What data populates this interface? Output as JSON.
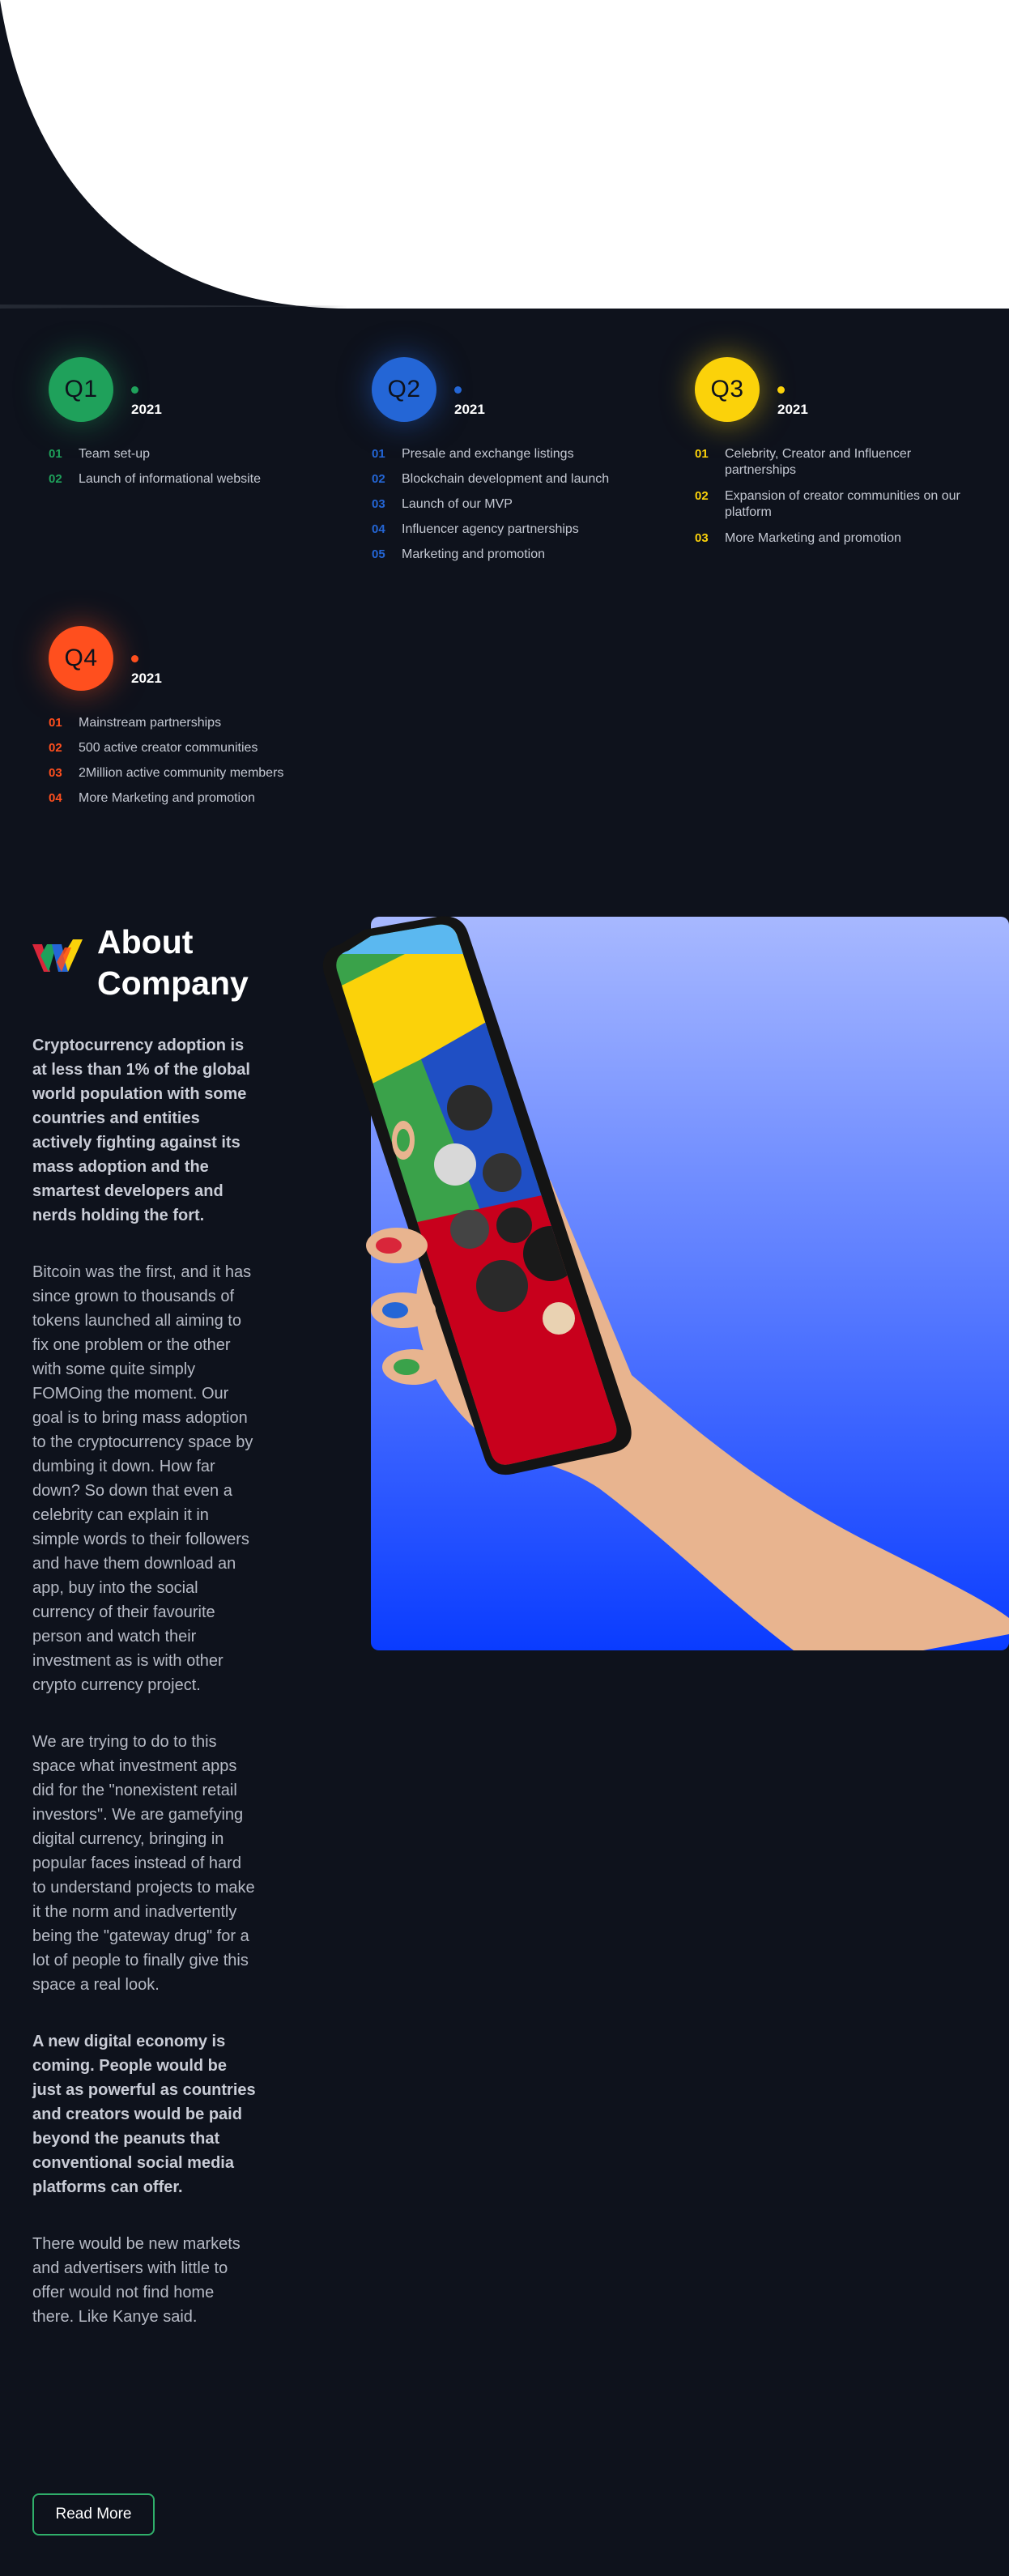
{
  "colors": {
    "background": "#0e121c",
    "q1": "#1fa15b",
    "q2": "#2466d6",
    "q3": "#fbd20a",
    "q4": "#ff4f1e",
    "button_border": "#2fae6a"
  },
  "roadmap": [
    {
      "quarter": "Q1",
      "year": "2021",
      "items": [
        {
          "num": "01",
          "text": "Team set-up"
        },
        {
          "num": "02",
          "text": "Launch of informational website"
        }
      ]
    },
    {
      "quarter": "Q2",
      "year": "2021",
      "items": [
        {
          "num": "01",
          "text": "Presale and exchange listings"
        },
        {
          "num": "02",
          "text": "Blockchain development and launch"
        },
        {
          "num": "03",
          "text": "Launch of our MVP"
        },
        {
          "num": "04",
          "text": "Influencer agency partnerships"
        },
        {
          "num": "05",
          "text": "Marketing and promotion"
        }
      ]
    },
    {
      "quarter": "Q3",
      "year": "2021",
      "items": [
        {
          "num": "01",
          "text": "Celebrity, Creator and Influencer partnerships"
        },
        {
          "num": "02",
          "text": "Expansion of creator communities on our platform"
        },
        {
          "num": "03",
          "text": "More Marketing and promotion"
        }
      ]
    },
    {
      "quarter": "Q4",
      "year": "2021",
      "items": [
        {
          "num": "01",
          "text": "Mainstream partnerships"
        },
        {
          "num": "02",
          "text": "500 active creator communities"
        },
        {
          "num": "03",
          "text": "2Million active community members"
        },
        {
          "num": "04",
          "text": "More Marketing and promotion"
        }
      ]
    }
  ],
  "about": {
    "title_line1": "About",
    "title_line2": "Company",
    "paragraphs": [
      "Cryptocurrency adoption is at less than 1% of the global world population with some countries and entities actively fighting against its mass adoption and the smartest developers and nerds holding the fort.",
      "Bitcoin was the first, and it has since grown to thousands of tokens launched all aiming to fix one problem or the other with some quite simply FOMOing the moment. Our goal is to bring mass adoption to the cryptocurrency space by dumbing it down. How far down? So down that even a celebrity can explain it in simple words to their followers and have them download an app, buy into the social currency of their favourite person and watch their investment as is with other crypto currency project.",
      "We are trying to do to this space what investment apps did for the \"nonexistent retail investors\". We are gamefying digital currency, bringing in popular faces instead of hard to understand projects to make it the norm and inadvertently being the \"gateway drug\" for a lot of people to finally give this space a real look.",
      "A new digital economy is coming. People would be just as powerful as countries and creators would be paid beyond the peanuts that conventional social media platforms can offer.",
      "There would be new markets and advertisers with little to offer would not find home there. Like Kanye said."
    ],
    "read_more_label": "Read More",
    "logo_icon": "w-logo-icon",
    "image_icon": "phone-in-hand-illustration"
  }
}
